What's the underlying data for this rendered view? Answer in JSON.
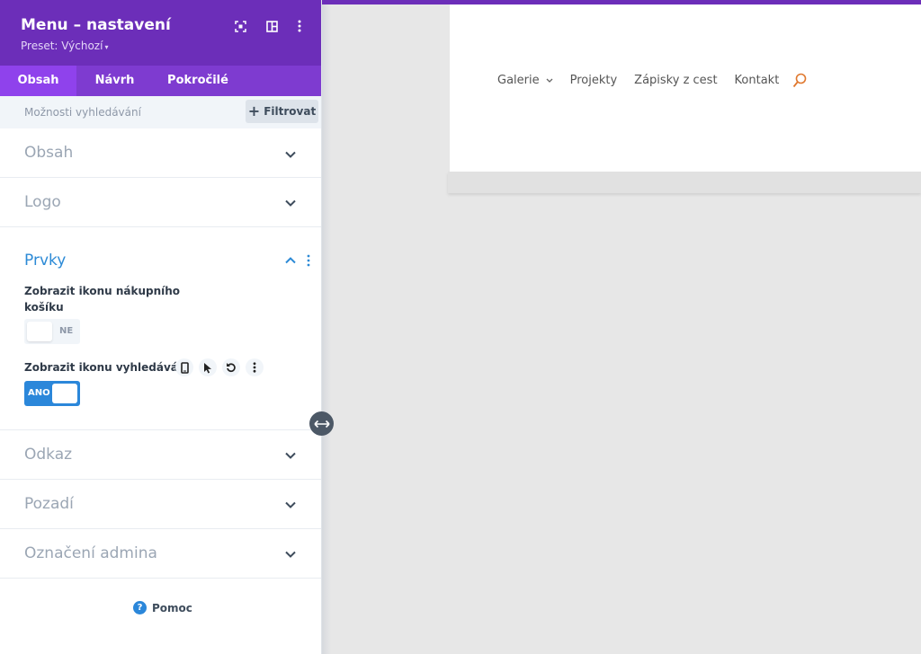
{
  "panel": {
    "title": "Menu – nastavení",
    "preset": "Preset: Výchozí",
    "header_icons": [
      "expand-icon",
      "split-view-icon",
      "more-vertical-icon"
    ],
    "tabs": [
      {
        "label": "Obsah",
        "active": true
      },
      {
        "label": "Návrh",
        "active": false
      },
      {
        "label": "Pokročilé",
        "active": false
      }
    ],
    "search_placeholder": "Možnosti vyhledávání",
    "filter_label": "Filtrovat",
    "sections": {
      "obsah": "Obsah",
      "logo": "Logo",
      "prvky": "Prvky",
      "odkaz": "Odkaz",
      "pozadi": "Pozadí",
      "oznaceni_admina": "Označení admina"
    },
    "prvky": {
      "cart_label": "Zobrazit ikonu nákupního košíku",
      "cart_toggle": "NE",
      "cart_enabled": false,
      "search_label": "Zobrazit ikonu vyhledávání",
      "search_toggle": "ANO",
      "search_enabled": true,
      "row_icons": [
        "phone-icon",
        "cursor-icon",
        "reset-icon",
        "more-vertical-icon"
      ]
    },
    "help_label": "Pomoc"
  },
  "preview": {
    "menu_items": [
      "Galerie",
      "Projekty",
      "Zápisky z cest",
      "Kontakt"
    ],
    "dropdown_on": "Galerie",
    "search_icon": "magnifier-icon"
  },
  "colors": {
    "header_purple": "#6c2eb9",
    "tab_purple": "#7e3bd0",
    "active_tab": "#8f42ec",
    "accent_blue": "#2b87da",
    "search_orange": "#e0782e"
  }
}
